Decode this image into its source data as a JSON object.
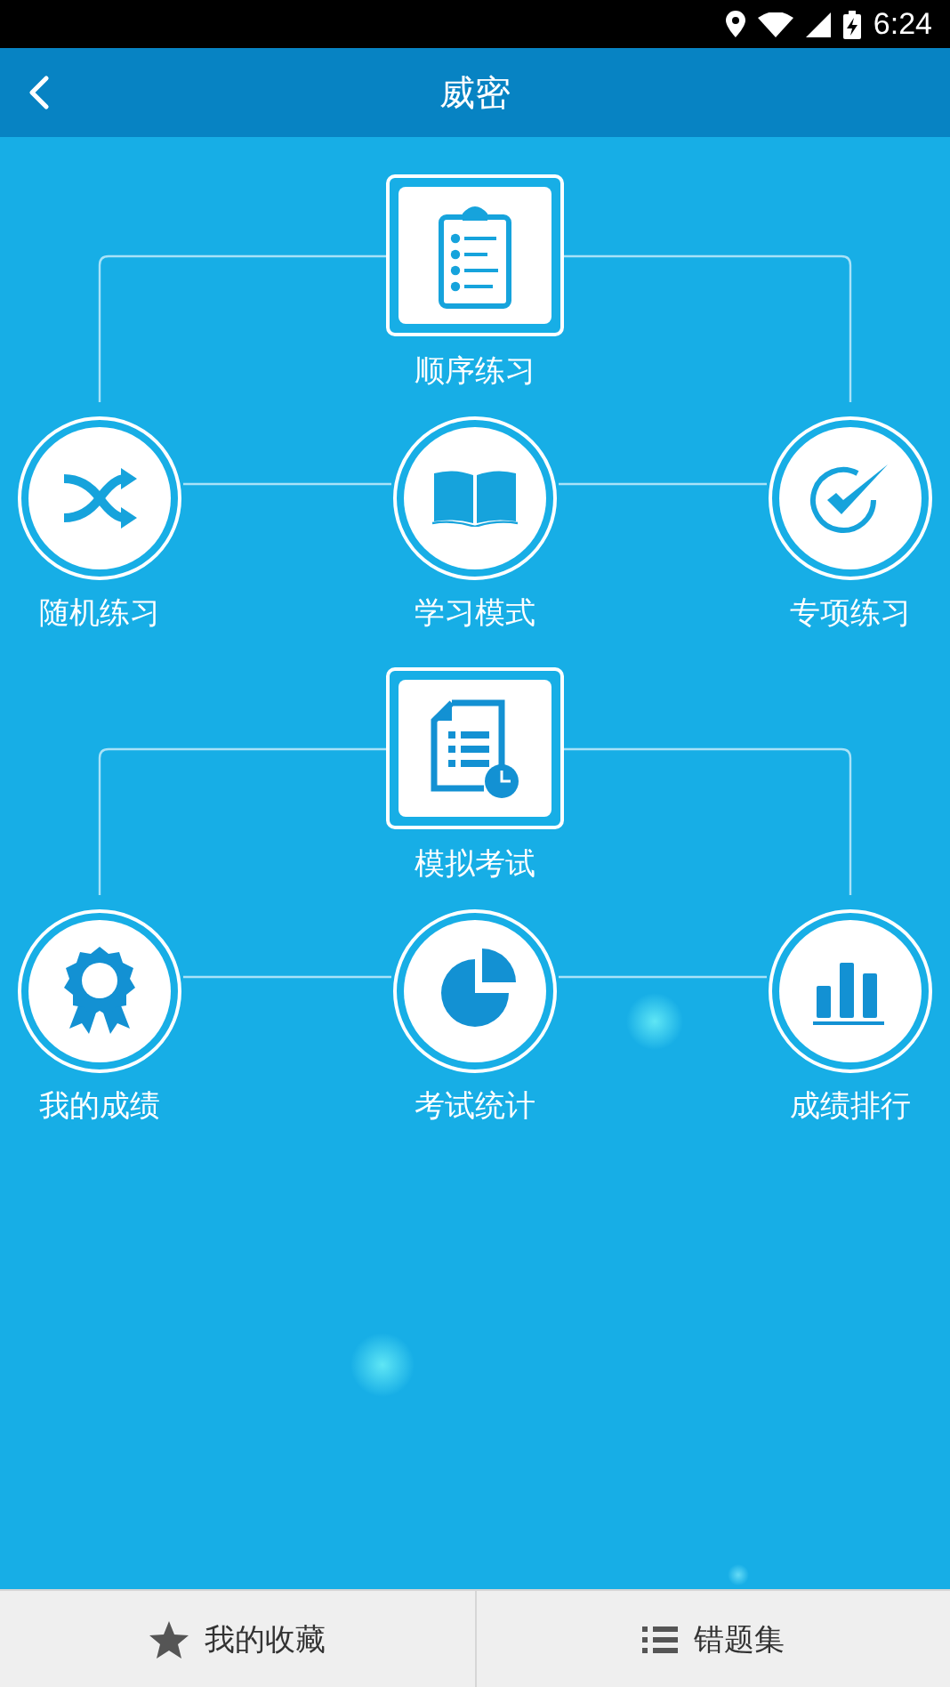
{
  "status_bar": {
    "time": "6:24"
  },
  "app_bar": {
    "title": "威密"
  },
  "sections": [
    {
      "top": {
        "label": "顺序练习"
      },
      "items": [
        {
          "label": "随机练习"
        },
        {
          "label": "学习模式"
        },
        {
          "label": "专项练习"
        }
      ]
    },
    {
      "top": {
        "label": "模拟考试"
      },
      "items": [
        {
          "label": "我的成绩"
        },
        {
          "label": "考试统计"
        },
        {
          "label": "成绩排行"
        }
      ]
    }
  ],
  "bottom_bar": [
    {
      "label": "我的收藏"
    },
    {
      "label": "错题集"
    }
  ]
}
